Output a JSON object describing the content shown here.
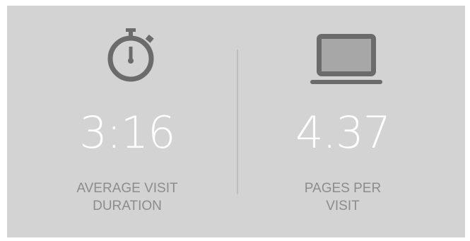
{
  "stats": [
    {
      "icon": "stopwatch-icon",
      "value": "3:16",
      "label_line1": "AVERAGE VISIT",
      "label_line2": "DURATION"
    },
    {
      "icon": "laptop-icon",
      "value": "4.37",
      "label_line1": "PAGES PER",
      "label_line2": "VISIT"
    }
  ],
  "colors": {
    "panel_background": "#d3d3d3",
    "icon": "#6b6b6b",
    "value_text": "#ffffff",
    "label_text": "#8c8c8c",
    "divider": "#bdbdbd"
  }
}
